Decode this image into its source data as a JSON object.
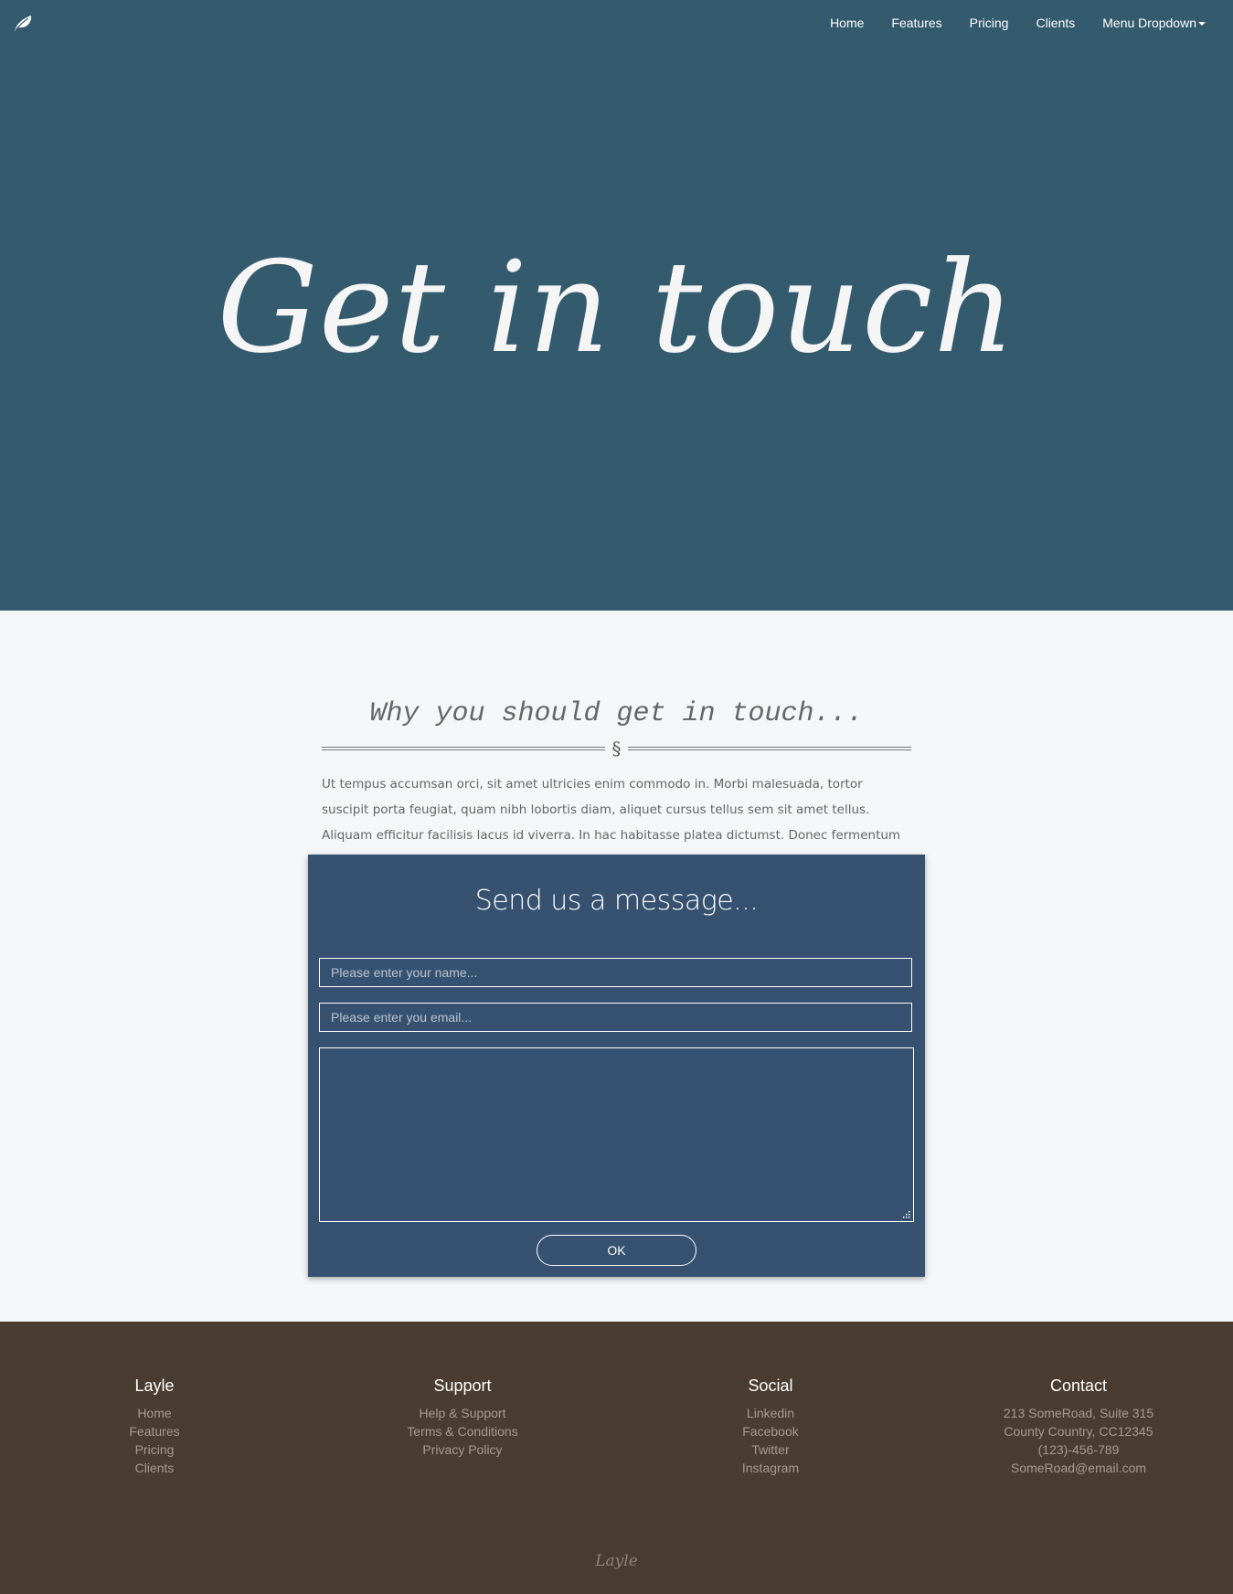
{
  "nav": {
    "logo_icon": "leaf-icon",
    "items": [
      "Home",
      "Features",
      "Pricing",
      "Clients",
      "Menu Dropdown"
    ]
  },
  "hero": {
    "title": "Get in touch",
    "background": "#345a6e"
  },
  "intro": {
    "heading": "Why you should get in touch...",
    "divider_symbol": "§",
    "paragraph": "Ut tempus accumsan orci, sit amet ultricies enim commodo in. Morbi malesuada, tortor suscipit porta feugiat, quam nibh lobortis diam, aliquet cursus tellus sem sit amet tellus. Aliquam efficitur facilisis lacus id viverra. In hac habitasse platea dictumst. Donec fermentum turpis in risus ultrices ultrices."
  },
  "form": {
    "title": "Send us a message...",
    "name_placeholder": "Please enter your name...",
    "email_placeholder": "Please enter you email...",
    "submit_label": "OK",
    "background": "#375271"
  },
  "footer": {
    "background": "#4a3c30",
    "columns": [
      {
        "title": "Layle",
        "items": [
          "Home",
          "Features",
          "Pricing",
          "Clients"
        ]
      },
      {
        "title": "Support",
        "items": [
          "Help & Support",
          "Terms & Conditions",
          "Privacy Policy"
        ]
      },
      {
        "title": "Social",
        "items": [
          "Linkedin",
          "Facebook",
          "Twitter",
          "Instagram"
        ]
      },
      {
        "title": "Contact",
        "items": [
          "213 SomeRoad, Suite 315",
          "County Country, CC12345",
          "(123)-456-789",
          "SomeRoad@email.com"
        ]
      }
    ],
    "brand": "Layle"
  }
}
